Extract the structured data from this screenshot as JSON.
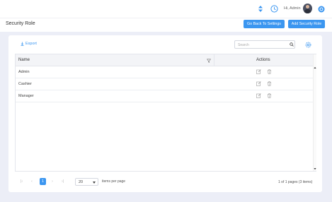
{
  "header": {
    "greeting": "Hi, Admin"
  },
  "page": {
    "title": "Security Role",
    "go_back_label": "Go Back To Settings",
    "add_label": "Add Security Role"
  },
  "toolbar": {
    "export_label": "Export",
    "search_placeholder": "Search"
  },
  "table": {
    "columns": [
      "Name",
      "Actions"
    ],
    "rows": [
      {
        "name": "Admin"
      },
      {
        "name": "Cashier"
      },
      {
        "name": "Manager"
      }
    ]
  },
  "pager": {
    "current_page": "1",
    "page_size": "20",
    "items_per_page_label": "items per page",
    "info": "1 of 1 pages (3 items)"
  },
  "colors": {
    "accent": "#3b96f0",
    "background": "#eceef7"
  }
}
